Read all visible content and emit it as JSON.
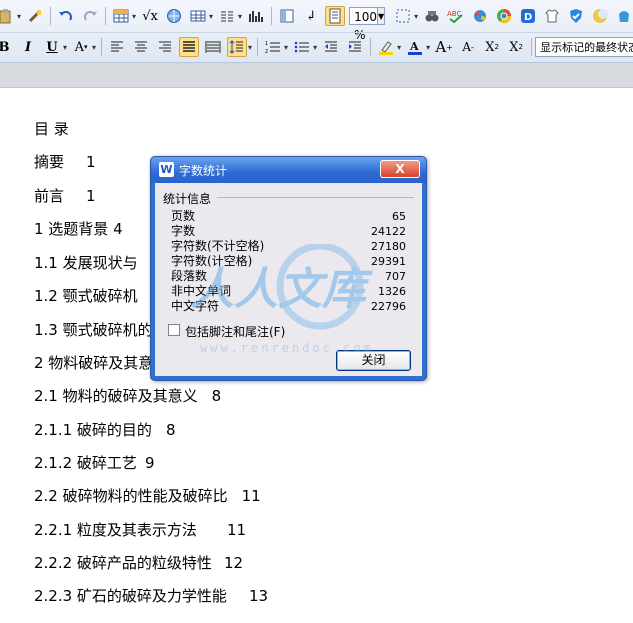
{
  "toolbar": {
    "zoom": "100 %",
    "markup_view": "显示标记的最终状态",
    "colors": {
      "highlight": "#f5d800",
      "font_color": "#1a3fd6"
    }
  },
  "document": {
    "lines": [
      {
        "text": "目 录",
        "page": ""
      },
      {
        "text": "摘要",
        "page": "1"
      },
      {
        "text": "前言",
        "page": "1"
      },
      {
        "text": "1  选题背景 4",
        "page": ""
      },
      {
        "text": "1.1    发展现状与",
        "page": ""
      },
      {
        "text": "1.2    颚式破碎机",
        "page": ""
      },
      {
        "text": "1.3 颚式破碎机的",
        "page": ""
      },
      {
        "text": "2  物料破碎及其意",
        "page": ""
      },
      {
        "text": "2.1    物料的破碎及其意义",
        "page": "8"
      },
      {
        "text": "2.1.1  破碎的目的",
        "page": "8"
      },
      {
        "text": "2.1.2  破碎工艺",
        "page": "9"
      },
      {
        "text": "2.2  破碎物料的性能及破碎比",
        "page": "11"
      },
      {
        "text": "2.2.1  粒度及其表示方法",
        "page": "11"
      },
      {
        "text": "2.2.2  破碎产品的粒级特性",
        "page": "12"
      },
      {
        "text": "2.2.3  矿石的破碎及力学性能",
        "page": "13"
      }
    ]
  },
  "dialog": {
    "title": "字数统计",
    "close_x": "X",
    "group_title": "统计信息",
    "stats": [
      {
        "label": "页数",
        "value": "65"
      },
      {
        "label": "字数",
        "value": "24122"
      },
      {
        "label": "字符数(不计空格)",
        "value": "27180"
      },
      {
        "label": "字符数(计空格)",
        "value": "29391"
      },
      {
        "label": "段落数",
        "value": "707"
      },
      {
        "label": "非中文单词",
        "value": "1326"
      },
      {
        "label": "中文字符",
        "value": "22796"
      }
    ],
    "checkbox_label": "包括脚注和尾注(F)",
    "checkbox_checked": false,
    "close_button": "关闭"
  },
  "watermark": {
    "text": "人人文库",
    "url": "www.renrendoc.com"
  }
}
